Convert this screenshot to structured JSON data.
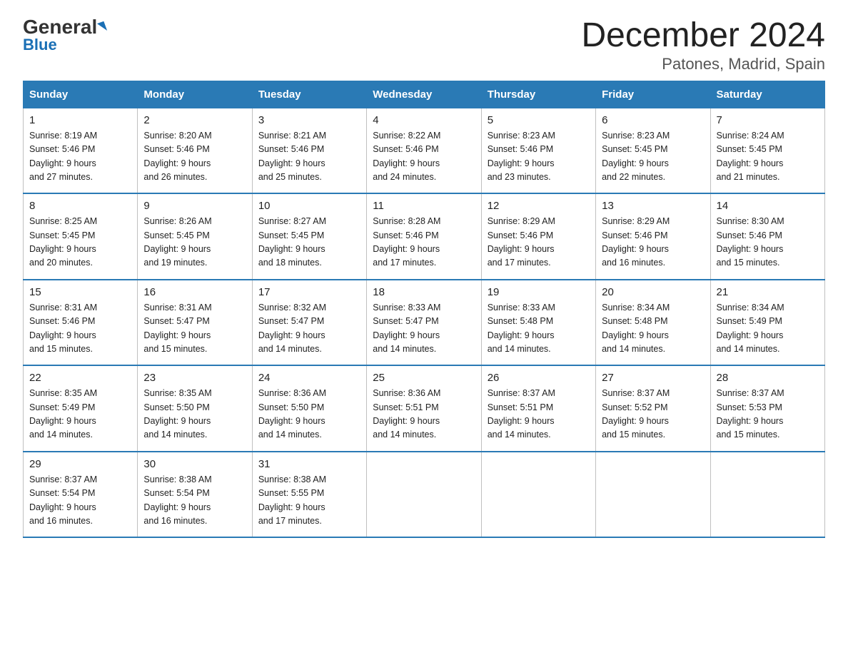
{
  "logo": {
    "general": "General",
    "blue": "Blue"
  },
  "title": "December 2024",
  "subtitle": "Patones, Madrid, Spain",
  "days_of_week": [
    "Sunday",
    "Monday",
    "Tuesday",
    "Wednesday",
    "Thursday",
    "Friday",
    "Saturday"
  ],
  "weeks": [
    [
      {
        "day": "1",
        "sunrise": "8:19 AM",
        "sunset": "5:46 PM",
        "daylight": "9 hours and 27 minutes."
      },
      {
        "day": "2",
        "sunrise": "8:20 AM",
        "sunset": "5:46 PM",
        "daylight": "9 hours and 26 minutes."
      },
      {
        "day": "3",
        "sunrise": "8:21 AM",
        "sunset": "5:46 PM",
        "daylight": "9 hours and 25 minutes."
      },
      {
        "day": "4",
        "sunrise": "8:22 AM",
        "sunset": "5:46 PM",
        "daylight": "9 hours and 24 minutes."
      },
      {
        "day": "5",
        "sunrise": "8:23 AM",
        "sunset": "5:46 PM",
        "daylight": "9 hours and 23 minutes."
      },
      {
        "day": "6",
        "sunrise": "8:23 AM",
        "sunset": "5:45 PM",
        "daylight": "9 hours and 22 minutes."
      },
      {
        "day": "7",
        "sunrise": "8:24 AM",
        "sunset": "5:45 PM",
        "daylight": "9 hours and 21 minutes."
      }
    ],
    [
      {
        "day": "8",
        "sunrise": "8:25 AM",
        "sunset": "5:45 PM",
        "daylight": "9 hours and 20 minutes."
      },
      {
        "day": "9",
        "sunrise": "8:26 AM",
        "sunset": "5:45 PM",
        "daylight": "9 hours and 19 minutes."
      },
      {
        "day": "10",
        "sunrise": "8:27 AM",
        "sunset": "5:45 PM",
        "daylight": "9 hours and 18 minutes."
      },
      {
        "day": "11",
        "sunrise": "8:28 AM",
        "sunset": "5:46 PM",
        "daylight": "9 hours and 17 minutes."
      },
      {
        "day": "12",
        "sunrise": "8:29 AM",
        "sunset": "5:46 PM",
        "daylight": "9 hours and 17 minutes."
      },
      {
        "day": "13",
        "sunrise": "8:29 AM",
        "sunset": "5:46 PM",
        "daylight": "9 hours and 16 minutes."
      },
      {
        "day": "14",
        "sunrise": "8:30 AM",
        "sunset": "5:46 PM",
        "daylight": "9 hours and 15 minutes."
      }
    ],
    [
      {
        "day": "15",
        "sunrise": "8:31 AM",
        "sunset": "5:46 PM",
        "daylight": "9 hours and 15 minutes."
      },
      {
        "day": "16",
        "sunrise": "8:31 AM",
        "sunset": "5:47 PM",
        "daylight": "9 hours and 15 minutes."
      },
      {
        "day": "17",
        "sunrise": "8:32 AM",
        "sunset": "5:47 PM",
        "daylight": "9 hours and 14 minutes."
      },
      {
        "day": "18",
        "sunrise": "8:33 AM",
        "sunset": "5:47 PM",
        "daylight": "9 hours and 14 minutes."
      },
      {
        "day": "19",
        "sunrise": "8:33 AM",
        "sunset": "5:48 PM",
        "daylight": "9 hours and 14 minutes."
      },
      {
        "day": "20",
        "sunrise": "8:34 AM",
        "sunset": "5:48 PM",
        "daylight": "9 hours and 14 minutes."
      },
      {
        "day": "21",
        "sunrise": "8:34 AM",
        "sunset": "5:49 PM",
        "daylight": "9 hours and 14 minutes."
      }
    ],
    [
      {
        "day": "22",
        "sunrise": "8:35 AM",
        "sunset": "5:49 PM",
        "daylight": "9 hours and 14 minutes."
      },
      {
        "day": "23",
        "sunrise": "8:35 AM",
        "sunset": "5:50 PM",
        "daylight": "9 hours and 14 minutes."
      },
      {
        "day": "24",
        "sunrise": "8:36 AM",
        "sunset": "5:50 PM",
        "daylight": "9 hours and 14 minutes."
      },
      {
        "day": "25",
        "sunrise": "8:36 AM",
        "sunset": "5:51 PM",
        "daylight": "9 hours and 14 minutes."
      },
      {
        "day": "26",
        "sunrise": "8:37 AM",
        "sunset": "5:51 PM",
        "daylight": "9 hours and 14 minutes."
      },
      {
        "day": "27",
        "sunrise": "8:37 AM",
        "sunset": "5:52 PM",
        "daylight": "9 hours and 15 minutes."
      },
      {
        "day": "28",
        "sunrise": "8:37 AM",
        "sunset": "5:53 PM",
        "daylight": "9 hours and 15 minutes."
      }
    ],
    [
      {
        "day": "29",
        "sunrise": "8:37 AM",
        "sunset": "5:54 PM",
        "daylight": "9 hours and 16 minutes."
      },
      {
        "day": "30",
        "sunrise": "8:38 AM",
        "sunset": "5:54 PM",
        "daylight": "9 hours and 16 minutes."
      },
      {
        "day": "31",
        "sunrise": "8:38 AM",
        "sunset": "5:55 PM",
        "daylight": "9 hours and 17 minutes."
      },
      null,
      null,
      null,
      null
    ]
  ],
  "labels": {
    "sunrise": "Sunrise:",
    "sunset": "Sunset:",
    "daylight": "Daylight:"
  }
}
